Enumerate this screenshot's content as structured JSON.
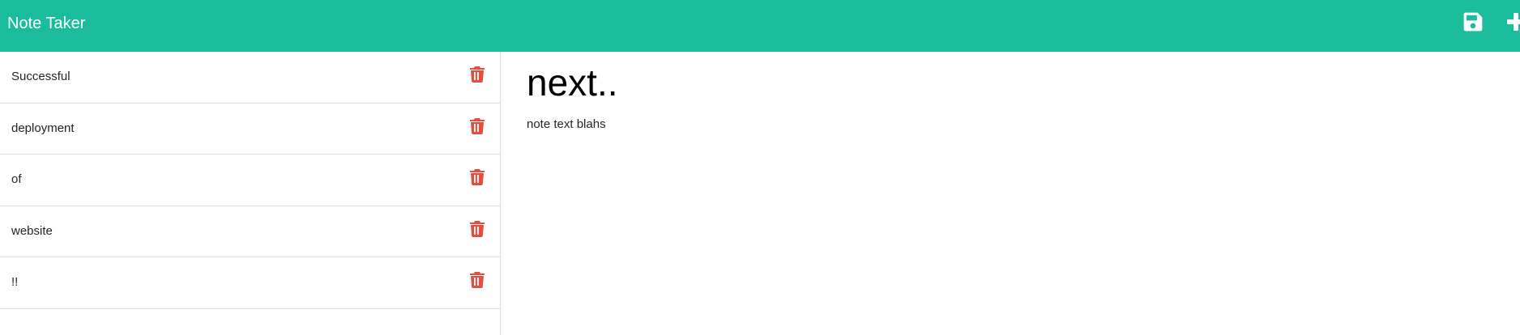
{
  "app": {
    "title": "Note Taker"
  },
  "colors": {
    "navbar": "#1abc9c",
    "delete_icon": "#e74c3c",
    "text": "#212529"
  },
  "icons": {
    "save": "save-icon",
    "new_note": "plus-icon",
    "delete": "trash-icon"
  },
  "notes": [
    {
      "title": "Successful"
    },
    {
      "title": "deployment"
    },
    {
      "title": "of"
    },
    {
      "title": "website"
    },
    {
      "title": "!!"
    }
  ],
  "active_note": {
    "title": "next..",
    "text": "note text blahs"
  }
}
